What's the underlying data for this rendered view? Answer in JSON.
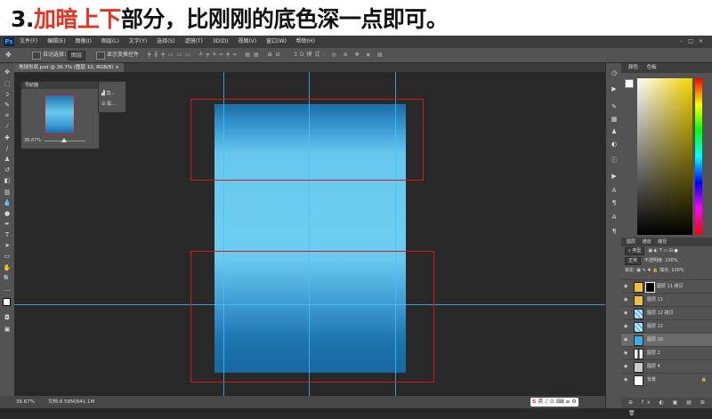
{
  "caption": {
    "prefix": "3.",
    "highlight": "加暗上下",
    "rest": "部分，比刚刚的底色深一点即可。"
  },
  "menubar": {
    "app_icon": "Ps",
    "menus": [
      "文件(F)",
      "编辑(E)",
      "图像(I)",
      "图层(L)",
      "文字(Y)",
      "选择(S)",
      "滤镜(T)",
      "3D(D)",
      "视图(V)",
      "窗口(W)",
      "帮助(H)"
    ],
    "window_buttons": [
      "–",
      "□",
      "×"
    ]
  },
  "options": {
    "auto_select": "自动选择：",
    "target": "图层",
    "show_transform": "显示变换控件"
  },
  "document_tab": {
    "title": "地球形状.psd @ 36.7% (图层 10, RGB/8)"
  },
  "navigator": {
    "title": "导航器",
    "zoom": "36.67%"
  },
  "mini_panel": {
    "row1": "直...",
    "row2": "属..."
  },
  "status": {
    "zoom": "36.67%",
    "doc": "文档:8.58M/841.1M",
    "ime": "英 ♪ ⊙ ⌨ ≡ ⚙"
  },
  "color_panel": {
    "tabs": [
      "颜色",
      "色板"
    ],
    "fg": "#ffffff",
    "bg": "#111111"
  },
  "layers_panel": {
    "tabs": [
      "图层",
      "通道",
      "路径"
    ],
    "filter": "类型",
    "blend": "正常",
    "opacity_label": "不透明度:",
    "opacity": "100%",
    "lock_label": "锁定:",
    "fill_label": "填充:",
    "fill": "100%",
    "layers": [
      {
        "name": "图层 11 拷贝",
        "thumb": "#f0c040",
        "mask": true,
        "selected": false
      },
      {
        "name": "图层 11",
        "thumb": "#f0c040",
        "mask": false,
        "selected": false
      },
      {
        "name": "图层 12 拷贝",
        "thumb": "#5ab8e8",
        "mask": false,
        "selected": false
      },
      {
        "name": "图层 12",
        "thumb": "#5ab8e8",
        "mask": false,
        "selected": false
      },
      {
        "name": "图层 10",
        "thumb": "#3ea9e6",
        "mask": false,
        "selected": true
      },
      {
        "name": "图层 2",
        "thumb": "#ffffff",
        "mask": false,
        "selected": false
      },
      {
        "name": "图层 4",
        "thumb": "#cccccc",
        "mask": false,
        "selected": false
      },
      {
        "name": "背景",
        "thumb": "#ffffff",
        "mask": false,
        "selected": false
      }
    ],
    "footer_icons": "⊕ fx ◐ ▣ ▤ ⊞ 🗑"
  }
}
